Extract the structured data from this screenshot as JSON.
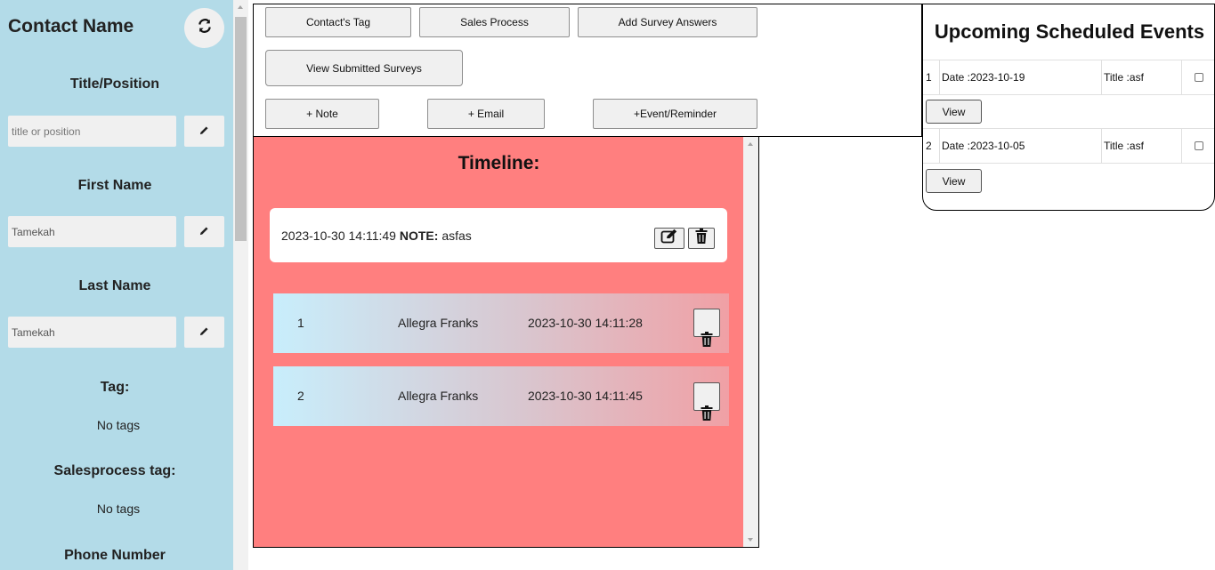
{
  "sidebar": {
    "title": "Contact Name",
    "refresh_icon": "refresh-icon",
    "title_position": {
      "label": "Title/Position",
      "placeholder": "title or position",
      "value": ""
    },
    "first_name": {
      "label": "First Name",
      "value": "Tamekah"
    },
    "last_name": {
      "label": "Last Name",
      "value": "Tamekah"
    },
    "tag": {
      "label": "Tag:",
      "value": "No tags"
    },
    "salesprocess_tag": {
      "label": "Salesprocess tag:",
      "value": "No tags"
    },
    "phone": {
      "label": "Phone Number"
    },
    "edit_icon": "pencil-icon"
  },
  "actions": {
    "contacts_tag": "Contact's Tag",
    "sales_process": "Sales Process",
    "add_survey_answers": "Add Survey Answers",
    "view_submitted_surveys": "View Submitted Surveys",
    "note": "+ Note",
    "email": "+ Email",
    "event_reminder": "+Event/Reminder"
  },
  "timeline": {
    "title": "Timeline:",
    "note": {
      "timestamp": "2023-10-30 14:11:49",
      "label": "NOTE:",
      "text": "asfas"
    },
    "entries": [
      {
        "index": "1",
        "name": "Allegra Franks",
        "timestamp": "2023-10-30 14:11:28"
      },
      {
        "index": "2",
        "name": "Allegra Franks",
        "timestamp": "2023-10-30 14:11:45"
      }
    ]
  },
  "events": {
    "title": "Upcoming Scheduled Events",
    "view_label": "View",
    "items": [
      {
        "index": "1",
        "date": "Date :2023-10-19",
        "title": "Title :asf"
      },
      {
        "index": "2",
        "date": "Date :2023-10-05",
        "title": "Title :asf"
      }
    ]
  },
  "colors": {
    "sidebar_bg": "#b3dbe8",
    "timeline_bg": "#ff7f7f"
  }
}
